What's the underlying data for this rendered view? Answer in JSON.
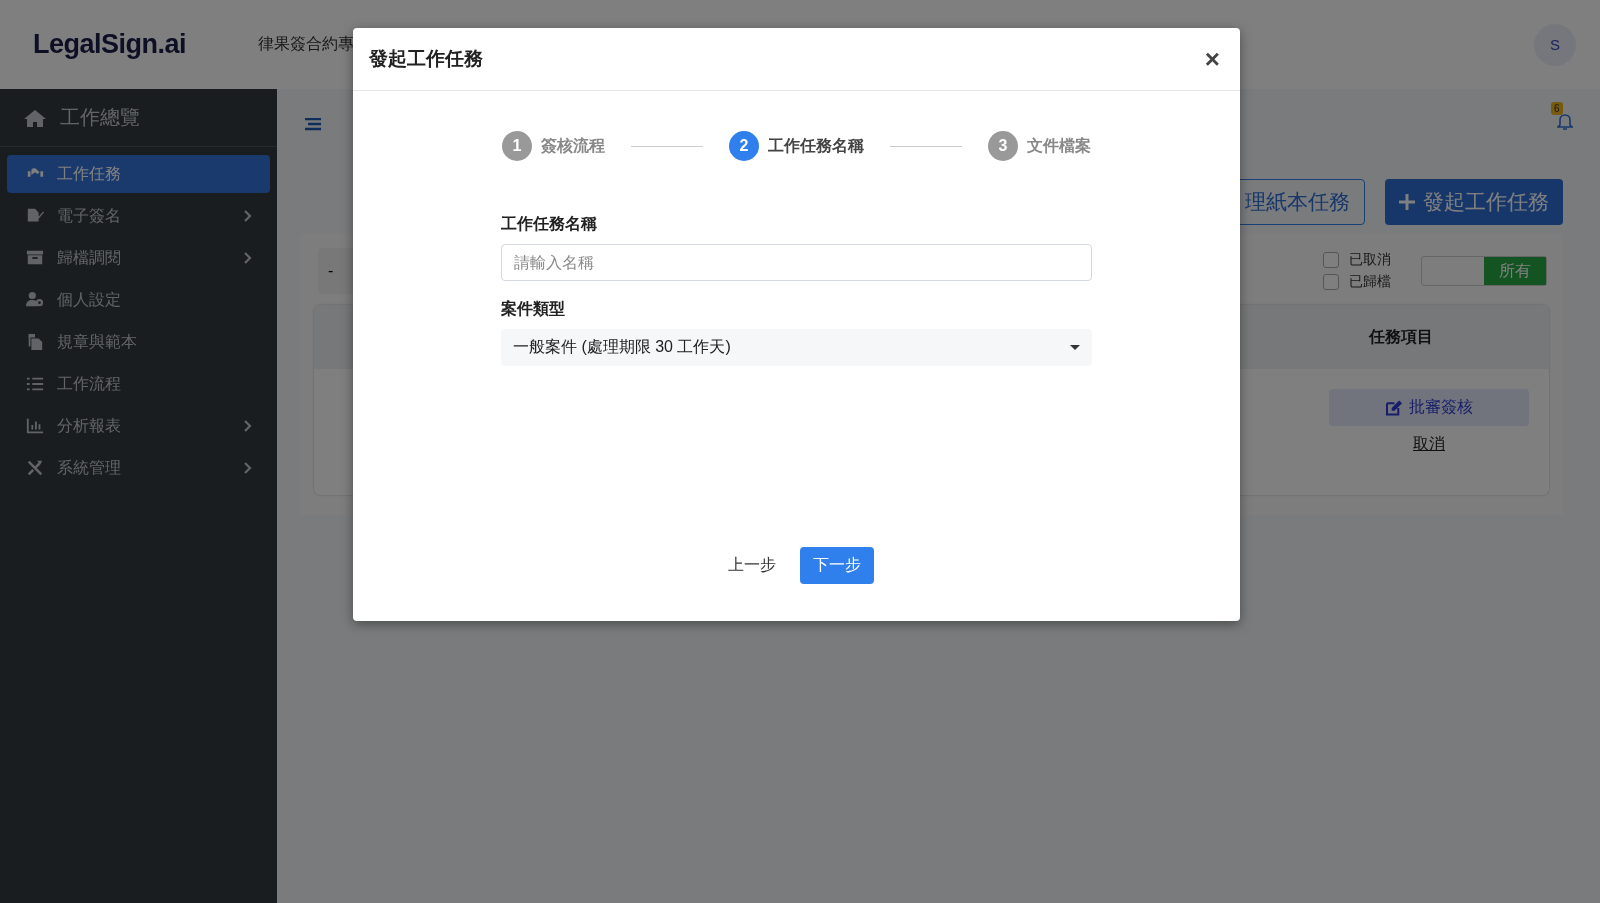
{
  "header": {
    "logo": "LegalSign.ai",
    "org": "律果簽合約專",
    "avatar": "S"
  },
  "sidebar": {
    "overview": "工作總覽",
    "items": [
      {
        "label": "工作任務",
        "selected": true,
        "expandable": false
      },
      {
        "label": "電子簽名",
        "selected": false,
        "expandable": true
      },
      {
        "label": "歸檔調閱",
        "selected": false,
        "expandable": true
      },
      {
        "label": "個人設定",
        "selected": false,
        "expandable": false
      },
      {
        "label": "規章與範本",
        "selected": false,
        "expandable": false
      },
      {
        "label": "工作流程",
        "selected": false,
        "expandable": false
      },
      {
        "label": "分析報表",
        "selected": false,
        "expandable": true
      },
      {
        "label": "系統管理",
        "selected": false,
        "expandable": true
      }
    ]
  },
  "main": {
    "notifications": "6",
    "buttons": [
      {
        "label": "理紙本任務",
        "kind": "outline"
      },
      {
        "label": "發起工作任務",
        "kind": "primary"
      }
    ],
    "filter": {
      "value": "-"
    },
    "checkboxes": [
      {
        "label": "已取消",
        "checked": false
      },
      {
        "label": "已歸檔",
        "checked": false
      }
    ],
    "toggle": {
      "label": "所有"
    },
    "table": {
      "columns": [
        "任務項目"
      ],
      "action": "批審簽核",
      "link": "取消"
    }
  },
  "modal": {
    "title": "發起工作任務",
    "close": "×",
    "steps": [
      {
        "number": "1",
        "label": "簽核流程",
        "selected": false
      },
      {
        "number": "2",
        "label": "工作任務名稱",
        "selected": true
      },
      {
        "number": "3",
        "label": "文件檔案",
        "selected": false
      }
    ],
    "fields": [
      {
        "kind": "text",
        "label": "工作任務名稱",
        "placeholder": "請輸入名稱"
      },
      {
        "kind": "select",
        "label": "案件類型",
        "value": "一般案件 (處理期限 30 工作天)"
      }
    ],
    "back": "上一步",
    "next": "下一步"
  }
}
